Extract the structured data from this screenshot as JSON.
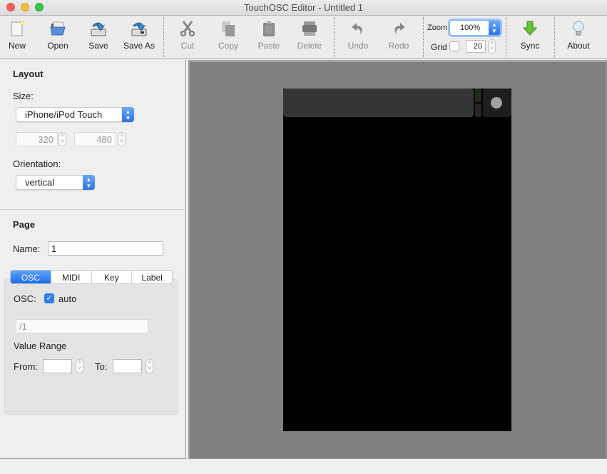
{
  "window": {
    "title": "TouchOSC Editor - Untitled 1"
  },
  "toolbar": {
    "buttons": [
      {
        "label": "New",
        "icon": "new-document-icon",
        "enabled": true
      },
      {
        "label": "Open",
        "icon": "folder-open-icon",
        "enabled": true
      },
      {
        "label": "Save",
        "icon": "save-icon",
        "enabled": true
      },
      {
        "label": "Save As",
        "icon": "save-as-icon",
        "enabled": true
      },
      {
        "label": "Cut",
        "icon": "scissors-icon",
        "enabled": false
      },
      {
        "label": "Copy",
        "icon": "copy-icon",
        "enabled": false
      },
      {
        "label": "Paste",
        "icon": "clipboard-icon",
        "enabled": false
      },
      {
        "label": "Delete",
        "icon": "shredder-icon",
        "enabled": false
      },
      {
        "label": "Undo",
        "icon": "undo-arrow-icon",
        "enabled": false
      },
      {
        "label": "Redo",
        "icon": "redo-arrow-icon",
        "enabled": false
      },
      {
        "label": "Sync",
        "icon": "download-arrow-icon",
        "enabled": true
      },
      {
        "label": "About",
        "icon": "lightbulb-icon",
        "enabled": true
      }
    ],
    "zoom": {
      "label": "Zoom",
      "value": "100%"
    },
    "grid": {
      "label": "Grid",
      "checked": false,
      "value": "20"
    }
  },
  "layout": {
    "heading": "Layout",
    "size_label": "Size:",
    "size_value": "iPhone/iPod Touch",
    "width": "320",
    "height": "480",
    "orientation_label": "Orientation:",
    "orientation_value": "vertical"
  },
  "page": {
    "heading": "Page",
    "name_label": "Name:",
    "name_value": "1",
    "tabs": [
      "OSC",
      "MIDI",
      "Key",
      "Label"
    ],
    "active_tab": "OSC",
    "osc": {
      "label": "OSC:",
      "auto_label": "auto",
      "auto_checked": true,
      "address": "/1",
      "value_range_label": "Value Range",
      "from_label": "From:",
      "from_value": "",
      "to_label": "To:",
      "to_value": ""
    }
  },
  "colors": {
    "accent": "#2c74e4",
    "canvas_bg": "#808080",
    "device_bg": "#000000",
    "page_bar": "#353535"
  }
}
